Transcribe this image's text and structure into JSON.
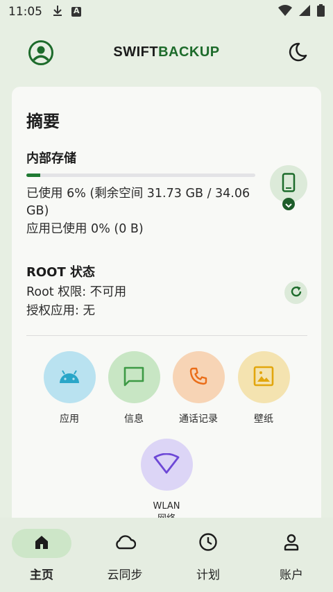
{
  "status_bar": {
    "time": "11:05",
    "icons": [
      "download-icon",
      "app-notification-icon",
      "wifi-icon",
      "signal-icon",
      "battery-icon"
    ]
  },
  "header": {
    "brand_part1": "SWIFT",
    "brand_part2": "BACKUP",
    "icons": [
      "profile-icon",
      "dark-mode-icon"
    ]
  },
  "summary": {
    "title": "摘要",
    "storage": {
      "title": "内部存储",
      "used_fraction": 0.06,
      "used_text": "已使用 6% (剩余空间 31.73 GB / 34.06 GB)",
      "apps_text": "应用已使用 0% (0 B)"
    },
    "root": {
      "title": "ROOT 状态",
      "access_text": "Root 权限: 不可用",
      "granted_text": "授权应用: 无"
    }
  },
  "categories": [
    {
      "label": "应用",
      "icon": "android-icon",
      "bg": "#b9e2f0",
      "fg": "#2aa6c8"
    },
    {
      "label": "信息",
      "icon": "message-icon",
      "bg": "#c8e6c4",
      "fg": "#3d9a45"
    },
    {
      "label": "通话记录",
      "icon": "phone-icon",
      "bg": "#f7d4b5",
      "fg": "#ea6d18"
    },
    {
      "label": "壁纸",
      "icon": "wallpaper-icon",
      "bg": "#f4e3b0",
      "fg": "#e2a60d"
    },
    {
      "label": "WLAN\n网络",
      "icon": "wifi-icon",
      "bg": "#dcd5f6",
      "fg": "#6d48d6"
    }
  ],
  "bottom_nav": [
    {
      "label": "主页",
      "icon": "home-icon",
      "active": true
    },
    {
      "label": "云同步",
      "icon": "cloud-icon",
      "active": false
    },
    {
      "label": "计划",
      "icon": "clock-icon",
      "active": false
    },
    {
      "label": "账户",
      "icon": "person-icon",
      "active": false
    }
  ],
  "colors": {
    "accent": "#1d6b2b",
    "background": "#e7efe3",
    "card": "#f8f9f6"
  }
}
